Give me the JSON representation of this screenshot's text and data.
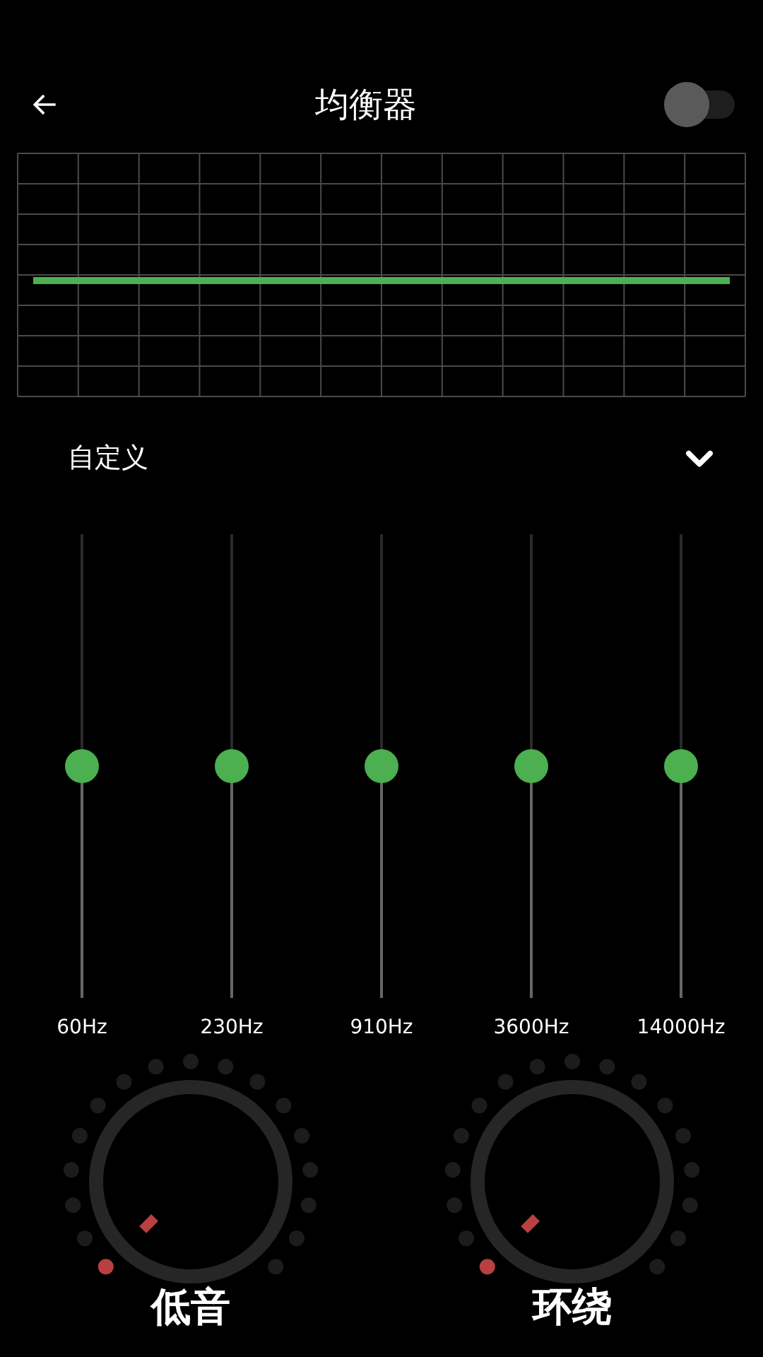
{
  "header": {
    "title": "均衡器",
    "toggle": {
      "on": false
    }
  },
  "preset": {
    "label": "自定义"
  },
  "bands": [
    {
      "label": "60Hz",
      "level": 0.5
    },
    {
      "label": "230Hz",
      "level": 0.5
    },
    {
      "label": "910Hz",
      "level": 0.5
    },
    {
      "label": "3600Hz",
      "level": 0.5
    },
    {
      "label": "14000Hz",
      "level": 0.5
    }
  ],
  "knobs": [
    {
      "label": "低音"
    },
    {
      "label": "环绕"
    }
  ]
}
